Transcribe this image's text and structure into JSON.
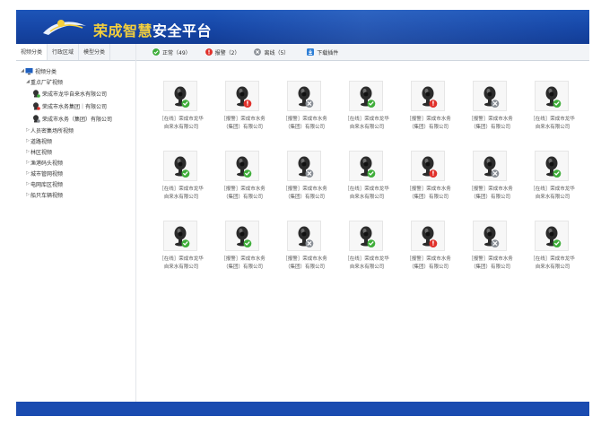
{
  "header": {
    "title_accent": "荣成智慧",
    "title_rest": "安全平台"
  },
  "sidebar": {
    "tabs": [
      {
        "label": "视频分类",
        "active": true
      },
      {
        "label": "行政区域",
        "active": false
      },
      {
        "label": "模型分类",
        "active": false
      }
    ],
    "tree": {
      "root": "视频分类",
      "items": [
        {
          "label": "重点厂矿视频",
          "expanded": true,
          "children": [
            "荣成市龙华自来水有限公司",
            "荣成市水务集团｜有限公司",
            "荣成市水务（集团）有限公司"
          ]
        },
        {
          "label": "人员密集场所视频",
          "expanded": false
        },
        {
          "label": "道路视频",
          "expanded": false
        },
        {
          "label": "林区视频",
          "expanded": false
        },
        {
          "label": "渔港码头视频",
          "expanded": false
        },
        {
          "label": "城市管网视频",
          "expanded": false
        },
        {
          "label": "电网库区视频",
          "expanded": false
        },
        {
          "label": "船只车辆视频",
          "expanded": false
        }
      ]
    }
  },
  "toolbar": {
    "items": [
      {
        "label": "正常（49）",
        "color": "#3fae3a",
        "icon": "check-icon"
      },
      {
        "label": "报警（2）",
        "color": "#e0302a",
        "icon": "alarm-icon"
      },
      {
        "label": "离线（5）",
        "color": "#8a8f96",
        "icon": "offline-icon"
      }
    ],
    "download_label": "下载插件"
  },
  "status_colors": {
    "online": "#3fae3a",
    "alarm": "#e0302a",
    "offline": "#8a8f96"
  },
  "cameras": [
    {
      "status": "online",
      "line1": "［在线］荣成市龙华",
      "line2": "自来水有限公司"
    },
    {
      "status": "alarm",
      "line1": "［报警］荣成市水务",
      "line2": "（集团）有限公司"
    },
    {
      "status": "offline",
      "line1": "［报警］荣成市水务",
      "line2": "（集团）有限公司"
    },
    {
      "status": "online",
      "line1": "［在线］荣成市龙华",
      "line2": "自来水有限公司"
    },
    {
      "status": "alarm",
      "line1": "［报警］荣成市水务",
      "line2": "（集团）有限公司"
    },
    {
      "status": "offline",
      "line1": "［报警］荣成市水务",
      "line2": "（集团）有限公司"
    },
    {
      "status": "online",
      "line1": "［在线］荣成市龙华",
      "line2": "自来水有限公司"
    },
    {
      "status": "online",
      "line1": "［在线］荣成市龙华",
      "line2": "自来水有限公司"
    },
    {
      "status": "online",
      "line1": "［报警］荣成市水务",
      "line2": "（集团）有限公司"
    },
    {
      "status": "offline",
      "line1": "［报警］荣成市水务",
      "line2": "（集团）有限公司"
    },
    {
      "status": "online",
      "line1": "［在线］荣成市龙华",
      "line2": "自来水有限公司"
    },
    {
      "status": "alarm",
      "line1": "［报警］荣成市水务",
      "line2": "（集团）有限公司"
    },
    {
      "status": "offline",
      "line1": "［报警］荣成市水务",
      "line2": "（集团）有限公司"
    },
    {
      "status": "online",
      "line1": "［在线］荣成市龙华",
      "line2": "自来水有限公司"
    },
    {
      "status": "online",
      "line1": "［在线］荣成市龙华",
      "line2": "自来水有限公司"
    },
    {
      "status": "online",
      "line1": "［报警］荣成市水务",
      "line2": "（集团）有限公司"
    },
    {
      "status": "offline",
      "line1": "［报警］荣成市水务",
      "line2": "（集团）有限公司"
    },
    {
      "status": "online",
      "line1": "［在线］荣成市龙华",
      "line2": "自来水有限公司"
    },
    {
      "status": "alarm",
      "line1": "［报警］荣成市水务",
      "line2": "（集团）有限公司"
    },
    {
      "status": "offline",
      "line1": "［报警］荣成市水务",
      "line2": "（集团）有限公司"
    },
    {
      "status": "online",
      "line1": "［在线］荣成市龙华",
      "line2": "自来水有限公司"
    }
  ]
}
